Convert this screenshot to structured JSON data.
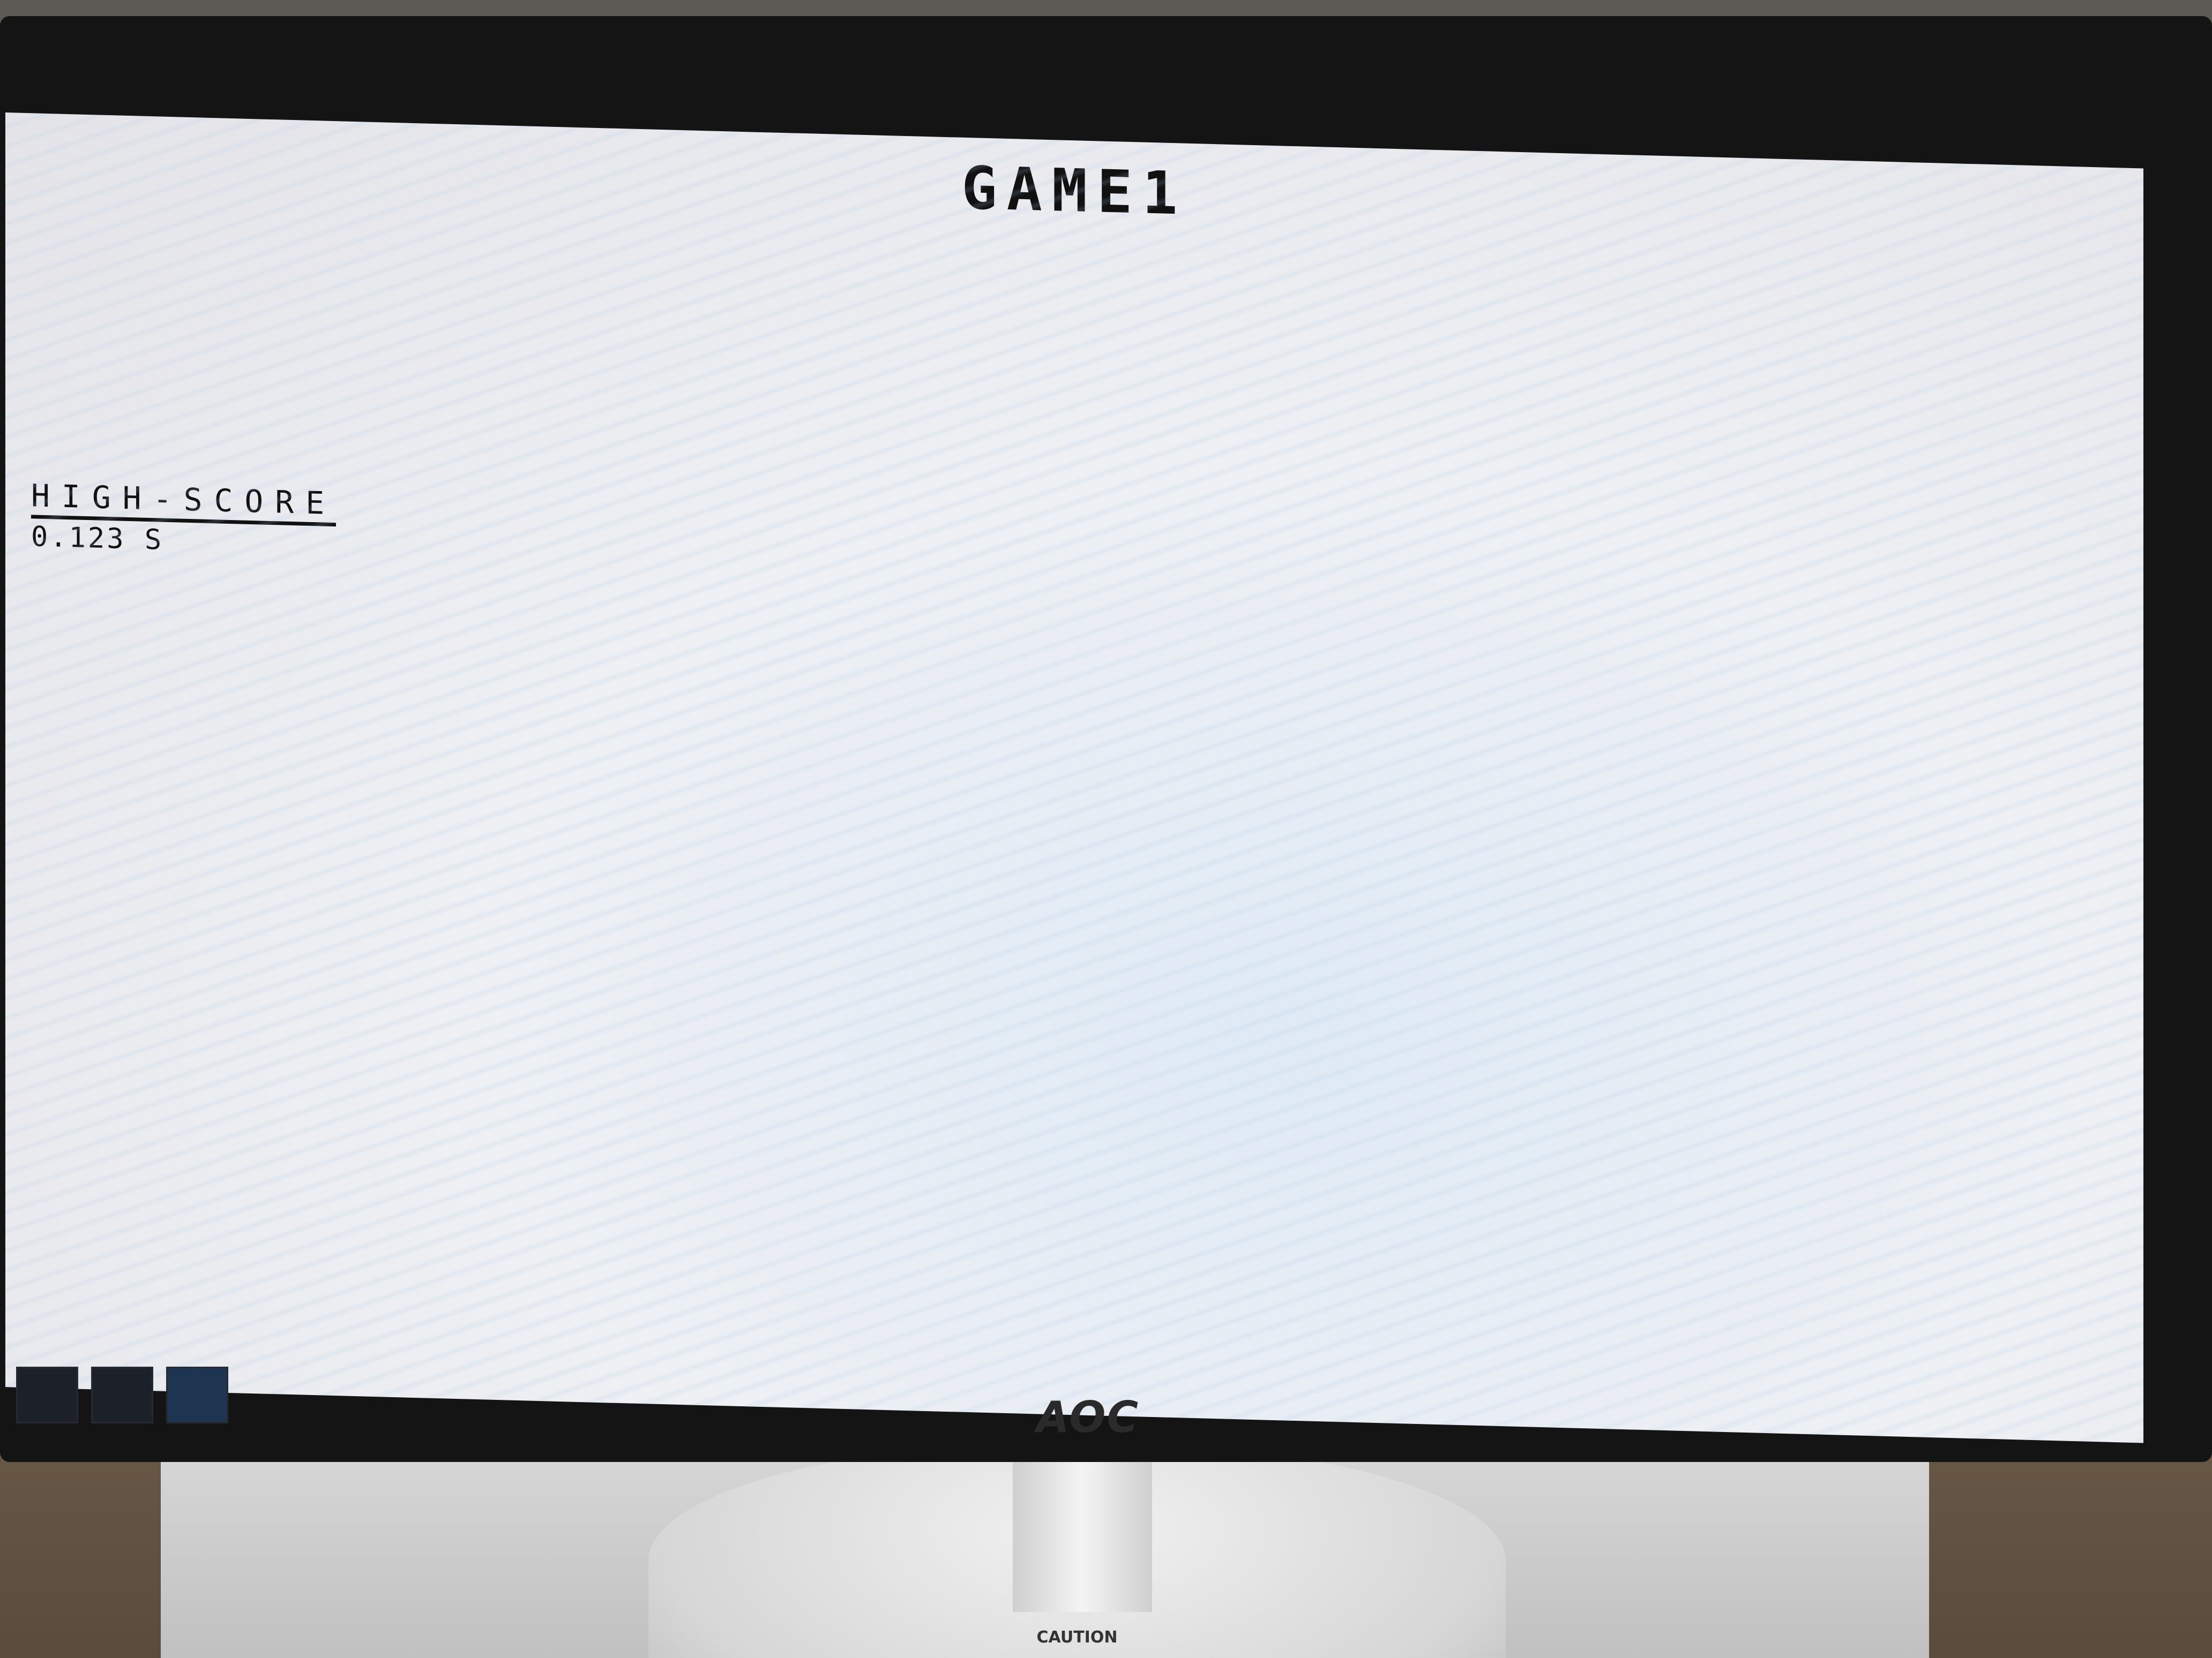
{
  "game": {
    "title": "GAME1",
    "high_score_label": "HIGH-SCORE",
    "high_score_value": "0.123 S"
  },
  "monitor": {
    "brand": "AOC"
  },
  "stand": {
    "caution_label": "CAUTION"
  }
}
